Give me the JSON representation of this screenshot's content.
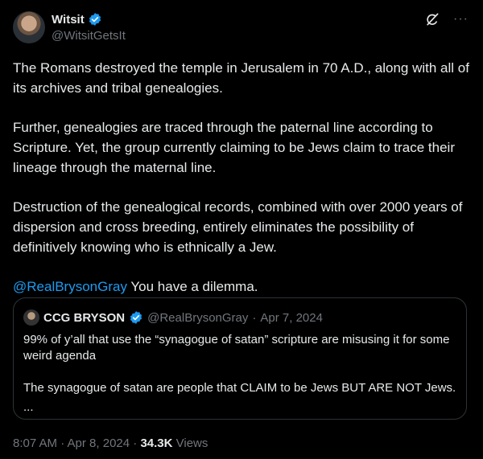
{
  "author": {
    "name": "Witsit",
    "handle": "@WitsitGetsIt",
    "verified_color": "#1d9bf0"
  },
  "icons": {
    "top_right": [
      "grok-icon",
      "more-icon"
    ],
    "more_glyph": "···"
  },
  "tweet": {
    "paragraphs": [
      "The Romans destroyed the temple in Jerusalem in 70 A.D., along with all of its archives and tribal genealogies.",
      "Further, genealogies are traced through the paternal line according to Scripture. Yet, the group currently claiming to be Jews claim to trace their lineage through the maternal line.",
      "Destruction of the genealogical records, combined with over 2000 years of dispersion and cross breeding, entirely eliminates the possibility of definitively knowing who is ethnically a Jew."
    ],
    "mention": "@RealBrysonGray",
    "closing": " You have a dilemma."
  },
  "quote": {
    "name": "CCG BRYSON",
    "handle": "@RealBrysonGray",
    "separator": "·",
    "date": "Apr 7, 2024",
    "paragraphs": [
      "99% of y’all that use the “synagogue of satan” scripture are misusing it for some weird agenda",
      "The synagogue of satan are people that CLAIM to be Jews BUT ARE NOT Jews."
    ],
    "ellipsis": "..."
  },
  "meta": {
    "time_date": "8:07 AM · Apr 8, 2024 · ",
    "views_count": "34.3K",
    "views_label": " Views"
  },
  "colors": {
    "background": "#000000",
    "text": "#e7e9ea",
    "muted": "#71767b",
    "link": "#1d9bf0",
    "border": "#2f3336"
  }
}
